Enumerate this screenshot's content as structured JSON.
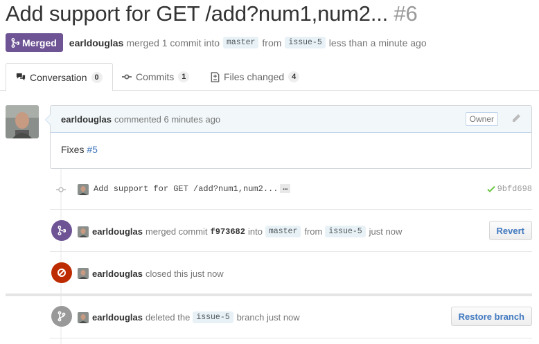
{
  "pr": {
    "title": "Add support for GET /add?num1,num2...",
    "number": "#6",
    "state": "Merged",
    "author": "earldouglas",
    "merged_text": "merged 1 commit into",
    "base_branch": "master",
    "from_text": "from",
    "head_branch": "issue-5",
    "time_text": "less than a minute ago"
  },
  "tabs": [
    {
      "label": "Conversation",
      "count": "0",
      "icon": "comment-discussion-icon"
    },
    {
      "label": "Commits",
      "count": "1",
      "icon": "git-commit-icon"
    },
    {
      "label": "Files changed",
      "count": "4",
      "icon": "file-diff-icon"
    }
  ],
  "comment": {
    "author": "earldouglas",
    "action": "commented 6 minutes ago",
    "badge": "Owner",
    "body_text": "Fixes",
    "issue_ref": "#5"
  },
  "commit": {
    "message": "Add support for GET /add?num1,num2...",
    "ellipsis": "…",
    "sha": "9bfd698",
    "status": "success"
  },
  "events": {
    "merged": {
      "author": "earldouglas",
      "text1": "merged commit",
      "sha": "f973682",
      "text2": "into",
      "base": "master",
      "text3": "from",
      "head": "issue-5",
      "time": "just now",
      "button": "Revert"
    },
    "closed": {
      "author": "earldouglas",
      "text": "closed this just now"
    },
    "deleted": {
      "author": "earldouglas",
      "text1": "deleted the",
      "branch": "issue-5",
      "text2": "branch just now",
      "button": "Restore branch"
    }
  },
  "colors": {
    "merged": "#6e5494",
    "closed": "#bd2c00",
    "deleted": "#999999",
    "link": "#4078c0",
    "success": "#6cc644"
  }
}
